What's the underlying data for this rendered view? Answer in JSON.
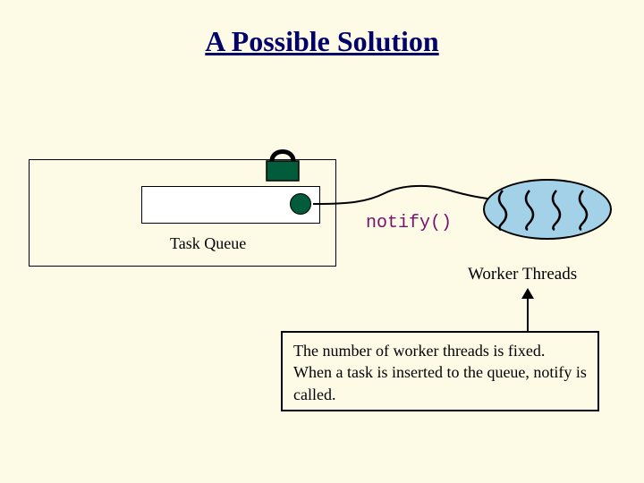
{
  "title": "A Possible Solution",
  "queue_label": "Task Queue",
  "notify_label": "notify()",
  "threads_label": "Worker Threads",
  "annotation": "The number of worker threads is fixed. When a task is inserted to the queue, notify is called.",
  "colors": {
    "background": "#fdfbe6",
    "title": "#02016a",
    "lock_body": "#005c3a",
    "notify_text": "#7a0f6e",
    "threads_fill": "#a3d1e8"
  },
  "thread_count": 4
}
